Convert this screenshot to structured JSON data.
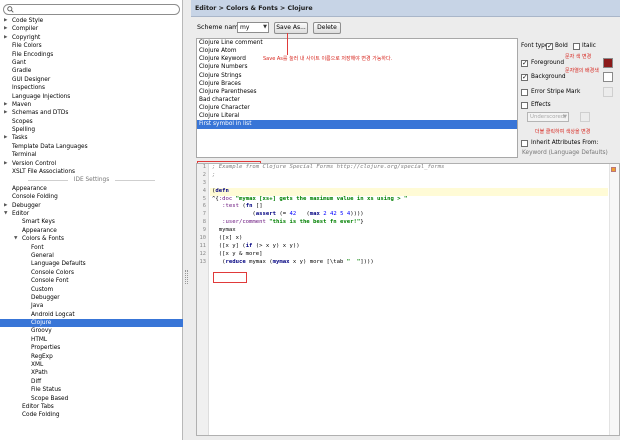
{
  "search": {
    "value": ""
  },
  "tree": {
    "items": [
      {
        "label": "Code Style",
        "level": 1,
        "arrow": "right"
      },
      {
        "label": "Compiler",
        "level": 1,
        "arrow": "right"
      },
      {
        "label": "Copyright",
        "level": 1,
        "arrow": "right"
      },
      {
        "label": "File Colors",
        "level": 1,
        "arrow": ""
      },
      {
        "label": "File Encodings",
        "level": 1,
        "arrow": ""
      },
      {
        "label": "Gant",
        "level": 1,
        "arrow": ""
      },
      {
        "label": "Gradle",
        "level": 1,
        "arrow": ""
      },
      {
        "label": "GUI Designer",
        "level": 1,
        "arrow": ""
      },
      {
        "label": "Inspections",
        "level": 1,
        "arrow": ""
      },
      {
        "label": "Language Injections",
        "level": 1,
        "arrow": ""
      },
      {
        "label": "Maven",
        "level": 1,
        "arrow": "right"
      },
      {
        "label": "Schemas and DTDs",
        "level": 1,
        "arrow": "right"
      },
      {
        "label": "Scopes",
        "level": 1,
        "arrow": ""
      },
      {
        "label": "Spelling",
        "level": 1,
        "arrow": ""
      },
      {
        "label": "Tasks",
        "level": 1,
        "arrow": "right"
      },
      {
        "label": "Template Data Languages",
        "level": 1,
        "arrow": ""
      },
      {
        "label": "Terminal",
        "level": 1,
        "arrow": ""
      },
      {
        "label": "Version Control",
        "level": 1,
        "arrow": "right"
      },
      {
        "label": "XSLT File Associations",
        "level": 1,
        "arrow": ""
      },
      {
        "label": "IDE Settings",
        "level": 0,
        "arrow": "",
        "separator": true
      },
      {
        "label": "Appearance",
        "level": 1,
        "arrow": ""
      },
      {
        "label": "Console Folding",
        "level": 1,
        "arrow": ""
      },
      {
        "label": "Debugger",
        "level": 1,
        "arrow": "right"
      },
      {
        "label": "Editor",
        "level": 1,
        "arrow": "down"
      },
      {
        "label": "Smart Keys",
        "level": 2,
        "arrow": ""
      },
      {
        "label": "Appearance",
        "level": 2,
        "arrow": ""
      },
      {
        "label": "Colors & Fonts",
        "level": 2,
        "arrow": "down"
      },
      {
        "label": "Font",
        "level": 3,
        "arrow": ""
      },
      {
        "label": "General",
        "level": 3,
        "arrow": ""
      },
      {
        "label": "Language Defaults",
        "level": 3,
        "arrow": ""
      },
      {
        "label": "Console Colors",
        "level": 3,
        "arrow": ""
      },
      {
        "label": "Console Font",
        "level": 3,
        "arrow": ""
      },
      {
        "label": "Custom",
        "level": 3,
        "arrow": ""
      },
      {
        "label": "Debugger",
        "level": 3,
        "arrow": ""
      },
      {
        "label": "Java",
        "level": 3,
        "arrow": ""
      },
      {
        "label": "Android Logcat",
        "level": 3,
        "arrow": ""
      },
      {
        "label": "Clojure",
        "level": 3,
        "arrow": "",
        "selected": true
      },
      {
        "label": "Groovy",
        "level": 3,
        "arrow": ""
      },
      {
        "label": "HTML",
        "level": 3,
        "arrow": ""
      },
      {
        "label": "Properties",
        "level": 3,
        "arrow": ""
      },
      {
        "label": "RegExp",
        "level": 3,
        "arrow": ""
      },
      {
        "label": "XML",
        "level": 3,
        "arrow": ""
      },
      {
        "label": "XPath",
        "level": 3,
        "arrow": ""
      },
      {
        "label": "Diff",
        "level": 3,
        "arrow": ""
      },
      {
        "label": "File Status",
        "level": 3,
        "arrow": ""
      },
      {
        "label": "Scope Based",
        "level": 3,
        "arrow": ""
      },
      {
        "label": "Editor Tabs",
        "level": 2,
        "arrow": ""
      },
      {
        "label": "Code Folding",
        "level": 2,
        "arrow": ""
      }
    ]
  },
  "breadcrumb": "Editor > Colors & Fonts > Clojure",
  "scheme": {
    "label": "Scheme name:",
    "value": "my",
    "saveas_label": "Save As...",
    "delete_label": "Delete"
  },
  "annotations": {
    "saveas": "Save As를 눌러 내 사이트 이름으로 저장해야 변경 가능하다.",
    "foreground": "문자 색 변경",
    "background": "문자열의 배경색",
    "click": "더블 클릭하여 색상을 변경"
  },
  "elements": [
    "Clojure Line comment",
    "Clojure Atom",
    "Clojure Keyword",
    "Clojure Numbers",
    "Clojure Strings",
    "Clojure Braces",
    "Clojure Parentheses",
    "Bad character",
    "Clojure Character",
    "Clojure Literal",
    "First symbol in list"
  ],
  "selected_element_index": 10,
  "options": {
    "font_type_label": "Font type:",
    "bold_label": "Bold",
    "bold_checked": true,
    "italic_label": "Italic",
    "italic_checked": false,
    "foreground_label": "Foreground",
    "foreground_checked": true,
    "foreground_color": "#8b1a1a",
    "background_label": "Background",
    "background_checked": true,
    "background_color": "#ffffff",
    "error_stripe_label": "Error Stripe Mark",
    "error_stripe_checked": false,
    "effects_label": "Effects",
    "effects_checked": false,
    "effects_value": "Underscored",
    "inherit_label": "Inherit Attributes From:",
    "inherit_checked": false,
    "inherit_value": "Keyword (Language Defaults)"
  },
  "code_lines": [
    "; Example from Clojure Special Forms http://clojure.org/special_forms",
    ";",
    "",
    "(defn",
    "^{:doc \"mymax [xs+] gets the maximum value in xs using > \"",
    "   :test (fn []",
    "            (assert (= 42   (max 2 42 5 4))))",
    "   :user/comment \"this is the best fn ever!\"}",
    "  mymax",
    "  ([x] x)",
    "  ([x y] (if (> x y) x y))",
    "  ([x y & more]",
    "   (reduce mymax (mymax x y) more [\\tab \"  \"])))"
  ],
  "line_numbers": [
    "1",
    "2",
    "3",
    "4",
    "5",
    "6",
    "7",
    "8",
    "9",
    "10",
    "11",
    "12",
    "13"
  ]
}
